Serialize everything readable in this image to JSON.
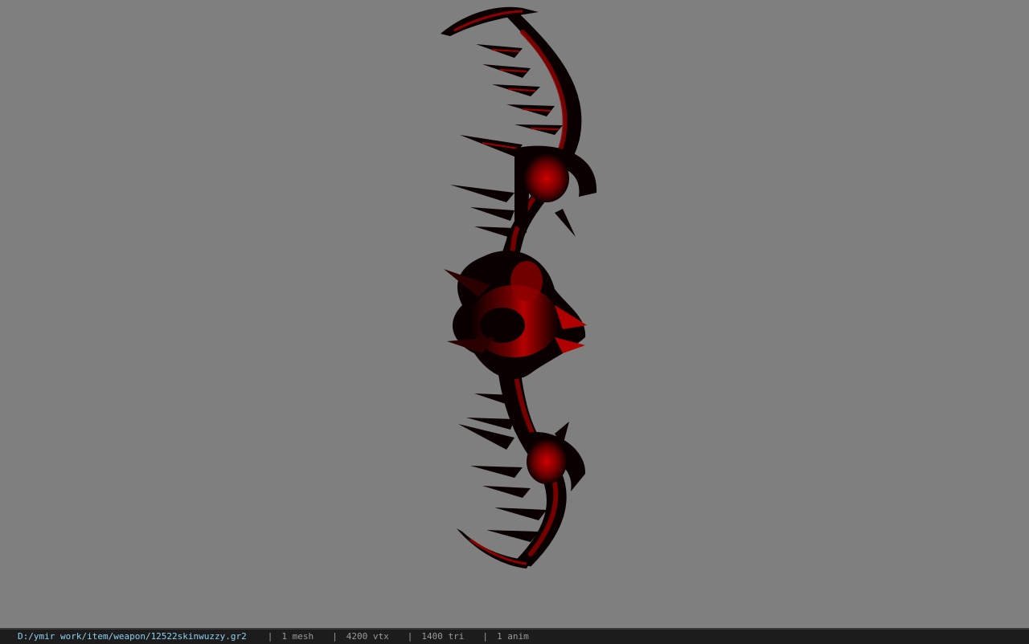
{
  "viewer": {
    "background_color": "#7f7f7f",
    "model_colors": {
      "dark": "#0a0000",
      "mid": "#5a0000",
      "bright": "#c00000"
    }
  },
  "status_bar": {
    "file_path": "D:/ymir work/item/weapon/12522skinwuzzy.gr2",
    "separator": "|",
    "mesh_count": "1 mesh",
    "vertex_count": "4200 vtx",
    "triangle_count": "1400 tri",
    "anim_count": "1 anim"
  }
}
